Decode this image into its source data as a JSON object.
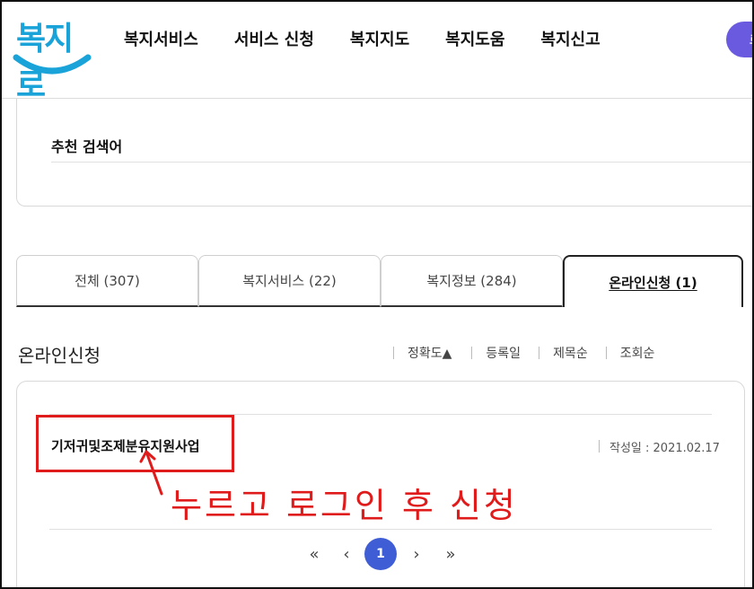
{
  "header": {
    "logo_text": "복지로",
    "nav": [
      "복지서비스",
      "서비스 신청",
      "복지지도",
      "복지도움",
      "복지신고"
    ],
    "login_label": "로"
  },
  "recommend": {
    "title": "추천 검색어"
  },
  "tabs": [
    {
      "label": "전체 (307)",
      "active": false
    },
    {
      "label": "복지서비스 (22)",
      "active": false
    },
    {
      "label": "복지정보 (284)",
      "active": false
    },
    {
      "label": "온라인신청 (1)",
      "active": true
    }
  ],
  "section": {
    "title": "온라인신청"
  },
  "sort": [
    "정확도▲",
    "등록일",
    "제목순",
    "조회순"
  ],
  "result": {
    "title": "기저귀및조제분유지원사업",
    "date_label": "작성일 : 2021.02.17"
  },
  "annotation": {
    "text": "누르고 로그인 후 신청",
    "color": "#e01b1b"
  },
  "pagination": {
    "first": "«",
    "prev": "‹",
    "current": "1",
    "next": "›",
    "last": "»"
  },
  "colors": {
    "brand": "#1aa3d9",
    "accent": "#3f5ed6",
    "login": "#6a5ae0"
  }
}
